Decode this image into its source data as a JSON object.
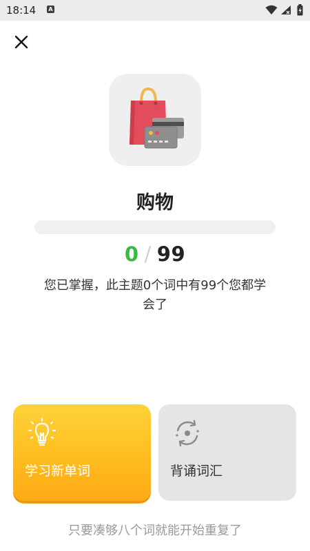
{
  "status_bar": {
    "time": "18:14",
    "notification_icon_letter": "A"
  },
  "topic": {
    "title": "购物",
    "learned_count": "0",
    "separator": "/",
    "total_count": "99",
    "progress_fraction": 0,
    "summary": "您已掌握，此主题0个词中有99个您都学会了"
  },
  "cards": {
    "learn_new": {
      "label": "学习新单词",
      "icon": "lightbulb-icon"
    },
    "review": {
      "label": "背诵词汇",
      "icon": "repeat-icon"
    }
  },
  "footer_note": "只要凑够八个词就能开始重复了",
  "colors": {
    "learned": "#3aba43",
    "learn_card": "#ffc21f",
    "review_card": "#e5e5e5"
  }
}
